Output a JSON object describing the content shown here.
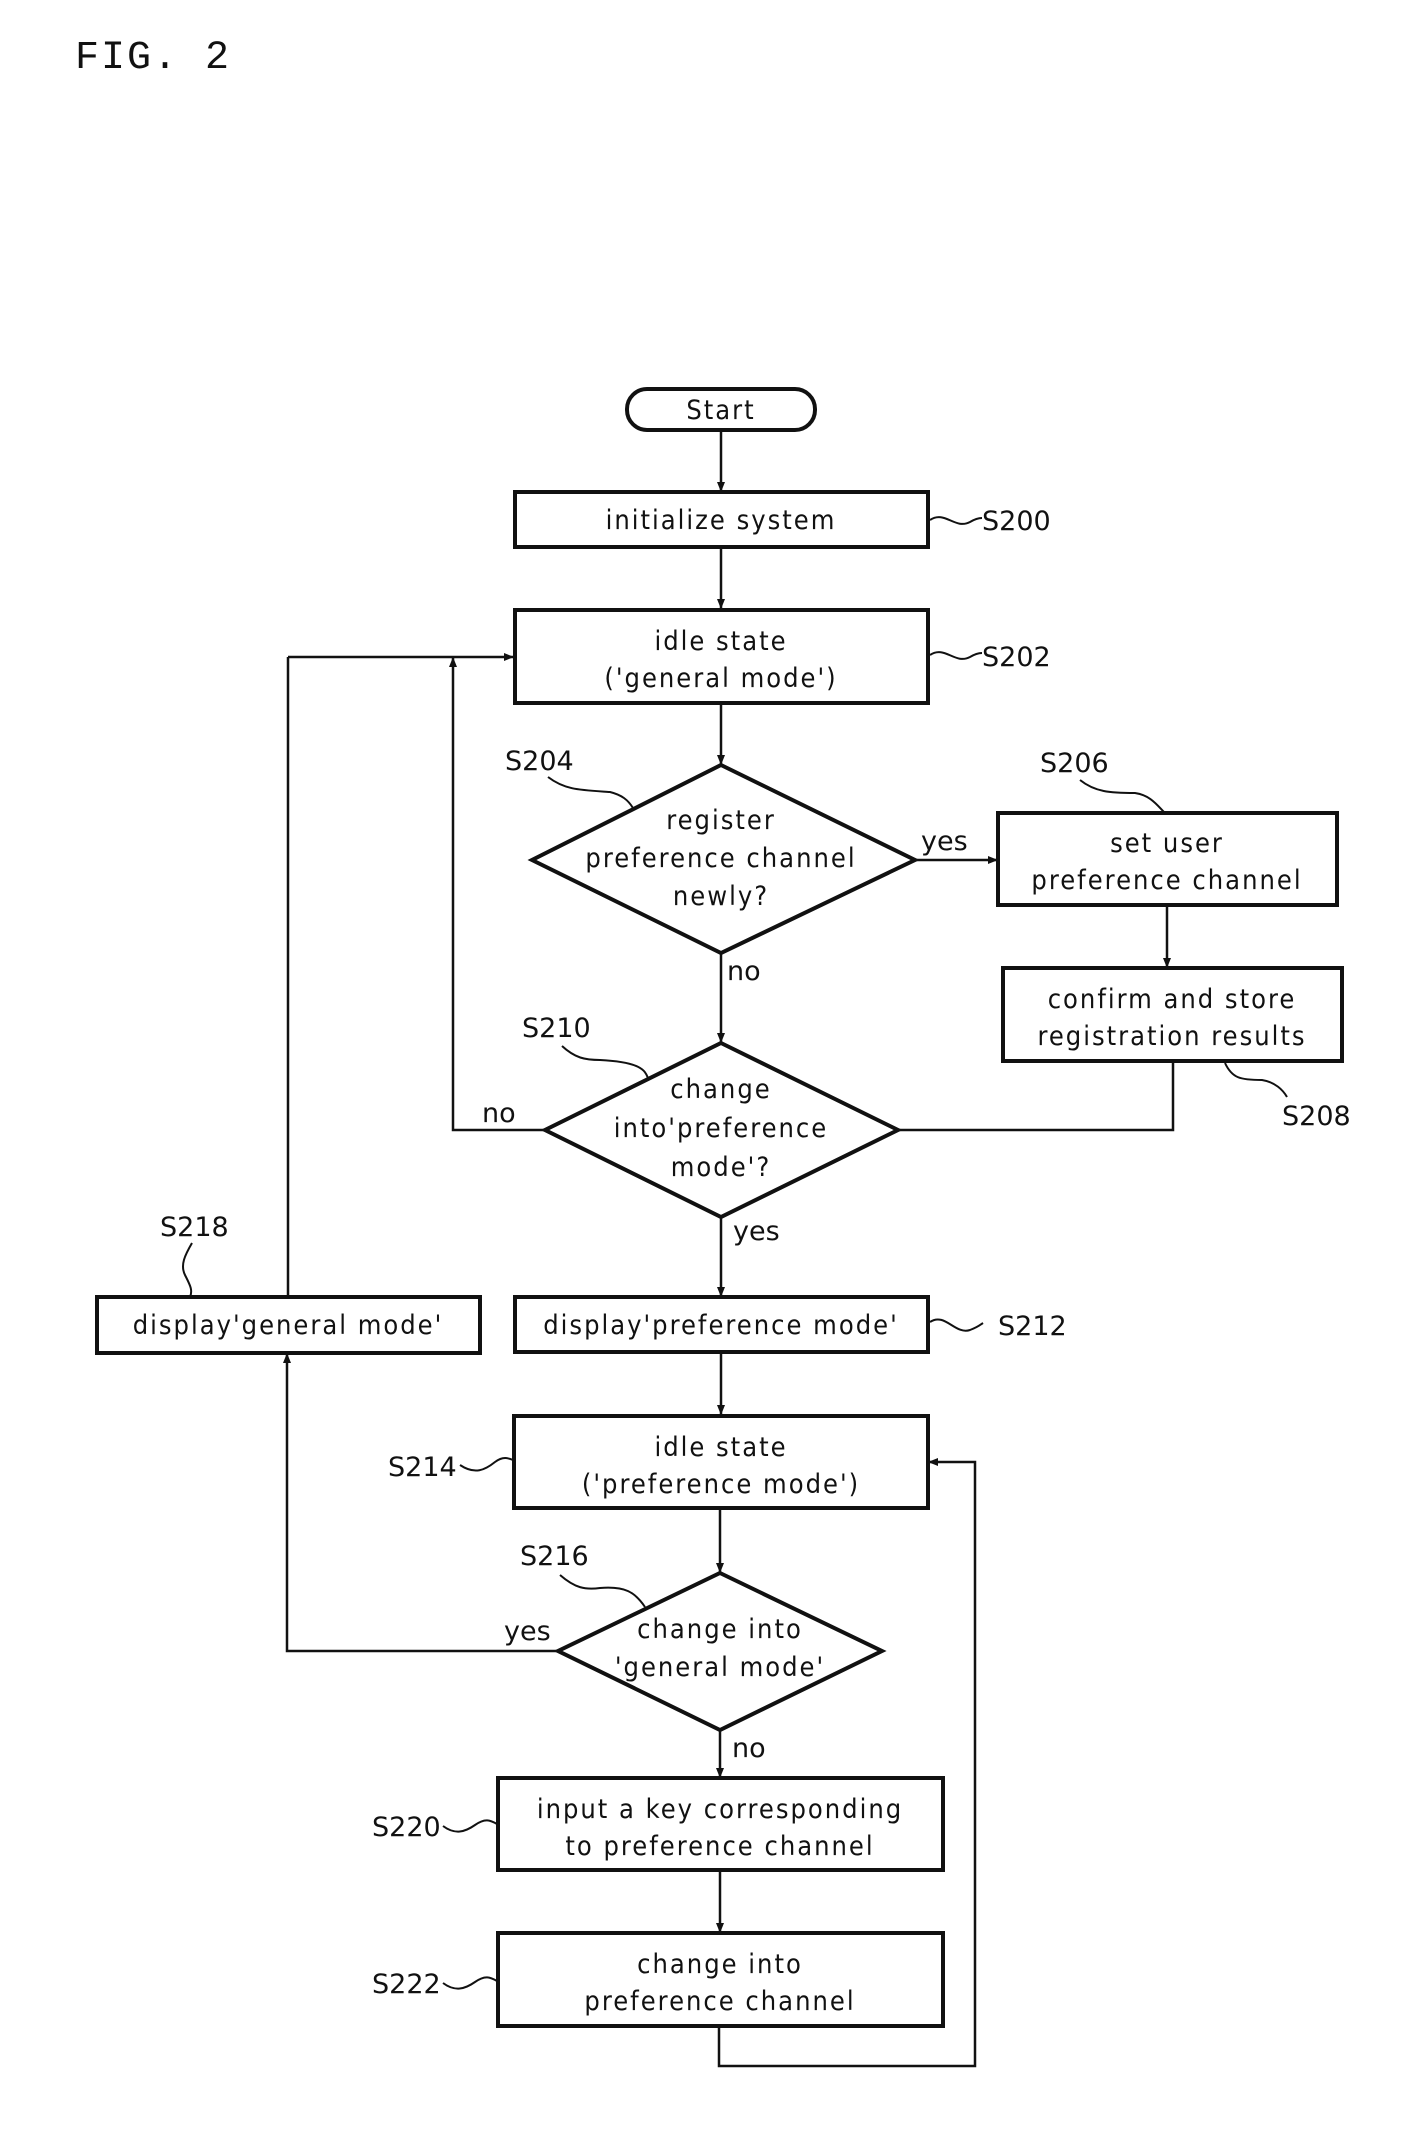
{
  "figure": {
    "title": "FIG. 2"
  },
  "steps": {
    "start": {
      "text": "Start"
    },
    "s200": {
      "ref": "S200",
      "lines": [
        "initialize system"
      ]
    },
    "s202": {
      "ref": "S202",
      "lines": [
        "idle state",
        "('general mode')"
      ]
    },
    "s204": {
      "ref": "S204",
      "lines": [
        "register",
        "preference channel",
        "newly?"
      ]
    },
    "s206": {
      "ref": "S206",
      "lines": [
        "set user",
        "preference channel"
      ]
    },
    "s208": {
      "ref": "S208",
      "lines": [
        "confirm and store",
        "registration results"
      ]
    },
    "s210": {
      "ref": "S210",
      "lines": [
        "change",
        "into'preference",
        "mode'?"
      ]
    },
    "s212": {
      "ref": "S212",
      "lines": [
        "display'preference mode'"
      ]
    },
    "s214": {
      "ref": "S214",
      "lines": [
        "idle state",
        "('preference mode')"
      ]
    },
    "s216": {
      "ref": "S216",
      "lines": [
        "change into",
        "'general mode'"
      ]
    },
    "s218": {
      "ref": "S218",
      "lines": [
        "display'general mode'"
      ]
    },
    "s220": {
      "ref": "S220",
      "lines": [
        "input a key corresponding",
        "to preference channel"
      ]
    },
    "s222": {
      "ref": "S222",
      "lines": [
        "change into",
        "preference channel"
      ]
    }
  },
  "branches": {
    "s204_yes": "yes",
    "s204_no": "no",
    "s210_no": "no",
    "s210_yes": "yes",
    "s216_yes": "yes",
    "s216_no": "no"
  }
}
